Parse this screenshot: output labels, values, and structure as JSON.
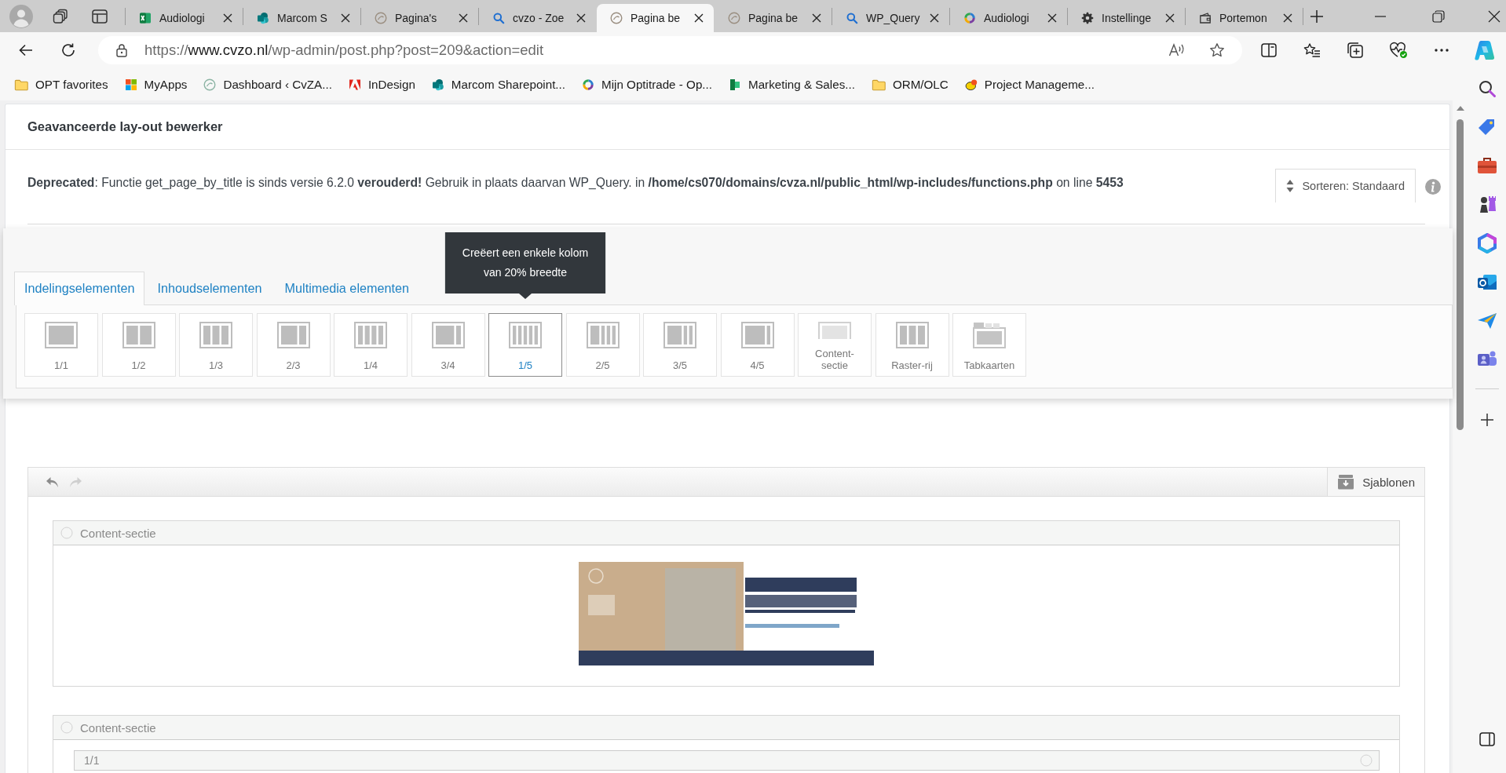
{
  "browser": {
    "tabs": [
      {
        "label": "Audiologi",
        "kind": "excel",
        "selected": false
      },
      {
        "label": "Marcom S",
        "kind": "sharepoint",
        "selected": false
      },
      {
        "label": "Pagina's",
        "kind": "cvzo",
        "selected": false
      },
      {
        "label": "cvzo - Zoe",
        "kind": "search",
        "selected": false
      },
      {
        "label": "Pagina be",
        "kind": "cvzo",
        "selected": true
      },
      {
        "label": "Pagina be",
        "kind": "cvzo",
        "selected": false
      },
      {
        "label": "WP_Query",
        "kind": "search",
        "selected": false
      },
      {
        "label": "Audiologi",
        "kind": "optitrade",
        "selected": false
      },
      {
        "label": "Instellinge",
        "kind": "settings",
        "selected": false
      },
      {
        "label": "Portemon",
        "kind": "wallet",
        "selected": false
      }
    ],
    "address": {
      "scheme": "https://",
      "host": "www.cvzo.nl",
      "path": "/wp-admin/post.php?post=209&action=edit"
    },
    "favorites": [
      {
        "label": "OPT favorites",
        "kind": "folder"
      },
      {
        "label": "MyApps",
        "kind": "apps"
      },
      {
        "label": "Dashboard ‹ CvZA...",
        "kind": "cvza"
      },
      {
        "label": "InDesign",
        "kind": "adobe"
      },
      {
        "label": "Marcom Sharepoint...",
        "kind": "sharepoint"
      },
      {
        "label": "Mijn Optitrade - Op...",
        "kind": "optitrade"
      },
      {
        "label": "Marketing & Sales...",
        "kind": "planner"
      },
      {
        "label": "ORM/OLC",
        "kind": "folder"
      },
      {
        "label": "Project Manageme...",
        "kind": "project"
      }
    ]
  },
  "editor": {
    "title": "Geavanceerde lay-out bewerker",
    "notice": "**Deprecated**: Functie get_page_by_title is sinds versie 6.2.0 **verouderd!** Gebruik in plaats daarvan WP_Query. in **/home/cs070/domains/cvza.nl/public_html/wp-includes/functions.php** on line **5453**",
    "sort_button": "Sorteren: Standaard",
    "element_panel": {
      "tabs": [
        {
          "label": "Indelingselementen",
          "selected": true
        },
        {
          "label": "Inhoudselementen",
          "selected": false
        },
        {
          "label": "Multimedia elementen",
          "selected": false
        }
      ],
      "tooltip": "Creëert een enkele kolom van 20% breedte",
      "elements": [
        {
          "label": "1/1",
          "kind": "full",
          "selected": false
        },
        {
          "label": "1/2",
          "kind": "halves",
          "selected": false
        },
        {
          "label": "1/3",
          "kind": "thirds",
          "selected": false
        },
        {
          "label": "2/3",
          "kind": "two-thirds",
          "selected": false
        },
        {
          "label": "1/4",
          "kind": "quarters",
          "selected": false
        },
        {
          "label": "3/4",
          "kind": "three-quarters",
          "selected": false
        },
        {
          "label": "1/5",
          "kind": "fifths",
          "selected": true
        },
        {
          "label": "2/5",
          "kind": "two-fifths",
          "selected": false
        },
        {
          "label": "3/5",
          "kind": "three-fifths",
          "selected": false
        },
        {
          "label": "4/5",
          "kind": "four-fifths",
          "selected": false
        },
        {
          "label": "Content-sectie",
          "kind": "section",
          "selected": false
        },
        {
          "label": "Raster-rij",
          "kind": "row",
          "selected": false
        },
        {
          "label": "Tabkaarten",
          "kind": "tabs",
          "selected": false
        }
      ]
    },
    "builder": {
      "undo": {
        "disabled": false
      },
      "redo": {
        "disabled": true
      },
      "templates_button": "Sjablonen",
      "sections": [
        {
          "title": "Content-sectie",
          "kind": "image"
        },
        {
          "title": "Content-sectie",
          "kind": "rows",
          "rows": [
            {
              "title": "1/1"
            }
          ]
        }
      ]
    }
  }
}
